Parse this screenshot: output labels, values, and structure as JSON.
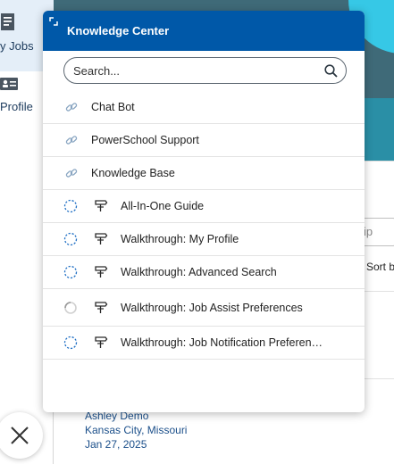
{
  "sidebar": {
    "items": [
      {
        "label": "y Jobs",
        "icon": "document-icon"
      },
      {
        "label": "Profile",
        "icon": "id-card-icon"
      }
    ]
  },
  "background": {
    "search_partial": "ip",
    "sort_partial": "Sort b",
    "card": {
      "name": "Ashley Demo",
      "location": "Kansas City, Missouri",
      "date": "Jan 27, 2025"
    }
  },
  "knowledge_center": {
    "title": "Knowledge Center",
    "search": {
      "placeholder": "Search...",
      "value": ""
    },
    "links": [
      {
        "label": "Chat Bot",
        "icon": "link-icon"
      },
      {
        "label": "PowerSchool Support",
        "icon": "link-icon"
      },
      {
        "label": "Knowledge Base",
        "icon": "link-icon"
      }
    ],
    "walkthroughs": [
      {
        "label": "All-In-One Guide",
        "status_icon": "progress-ring-icon",
        "icon": "signpost-icon"
      },
      {
        "label": "Walkthrough: My Profile",
        "status_icon": "progress-ring-icon",
        "icon": "signpost-icon"
      },
      {
        "label": "Walkthrough: Advanced Search",
        "status_icon": "progress-ring-icon",
        "icon": "signpost-icon"
      },
      {
        "label": "Walkthrough: Job Assist Preferences",
        "status_icon": "loading-spinner-icon",
        "icon": "signpost-icon"
      },
      {
        "label": "Walkthrough: Job Notification Preferen…",
        "status_icon": "progress-ring-icon",
        "icon": "signpost-icon"
      }
    ]
  },
  "colors": {
    "header_bg": "#0058a8",
    "icon_blue": "#1f6fc4",
    "text_dark": "#222222",
    "link_text": "#1b4f8a"
  }
}
